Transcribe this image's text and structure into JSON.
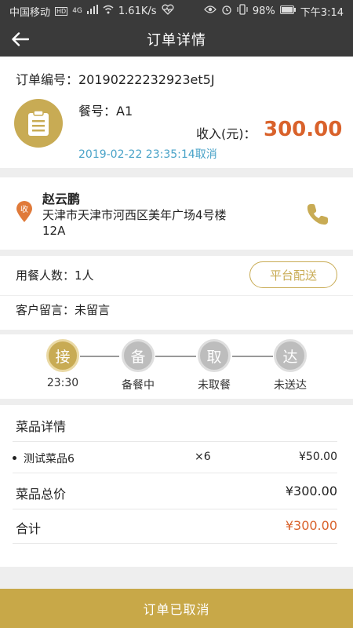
{
  "status_bar": {
    "carrier": "中国移动",
    "hd": "HD",
    "net": "4G",
    "speed": "1.61K/s",
    "battery": "98%",
    "time": "下午3:14"
  },
  "header": {
    "title": "订单详情"
  },
  "order": {
    "order_no": "订单编号：20190222232923et5J",
    "meal_no": "餐号：A1",
    "income_label": "收入(元)：",
    "income_value": "300.00",
    "time_status": "2019-02-22 23:35:14取消"
  },
  "customer": {
    "pin_label": "收",
    "name": "赵云鹏",
    "address_line1": "天津市天津市河西区美年广场4号楼",
    "address_line2": "12A"
  },
  "info": {
    "diners": "用餐人数：1人",
    "delivery_badge": "平台配送",
    "remark": "客户留言：未留言"
  },
  "progress": {
    "steps": [
      {
        "char": "接",
        "label": "23:30",
        "active": true
      },
      {
        "char": "备",
        "label": "备餐中",
        "active": false
      },
      {
        "char": "取",
        "label": "未取餐",
        "active": false
      },
      {
        "char": "达",
        "label": "未送达",
        "active": false
      }
    ]
  },
  "dishes": {
    "title": "菜品详情",
    "items": [
      {
        "name": "测试菜品6",
        "qty": "×6",
        "price": "¥50.00"
      }
    ],
    "subtotal_label": "菜品总价",
    "subtotal_value": "¥300.00",
    "total_label": "合计",
    "total_value": "¥300.00"
  },
  "footer": {
    "status_button": "订单已取消"
  },
  "colors": {
    "accent_gold": "#c8ab54",
    "income_orange": "#d9622b",
    "time_blue": "#4aa3c8",
    "header_dark": "#3a3a3a"
  }
}
